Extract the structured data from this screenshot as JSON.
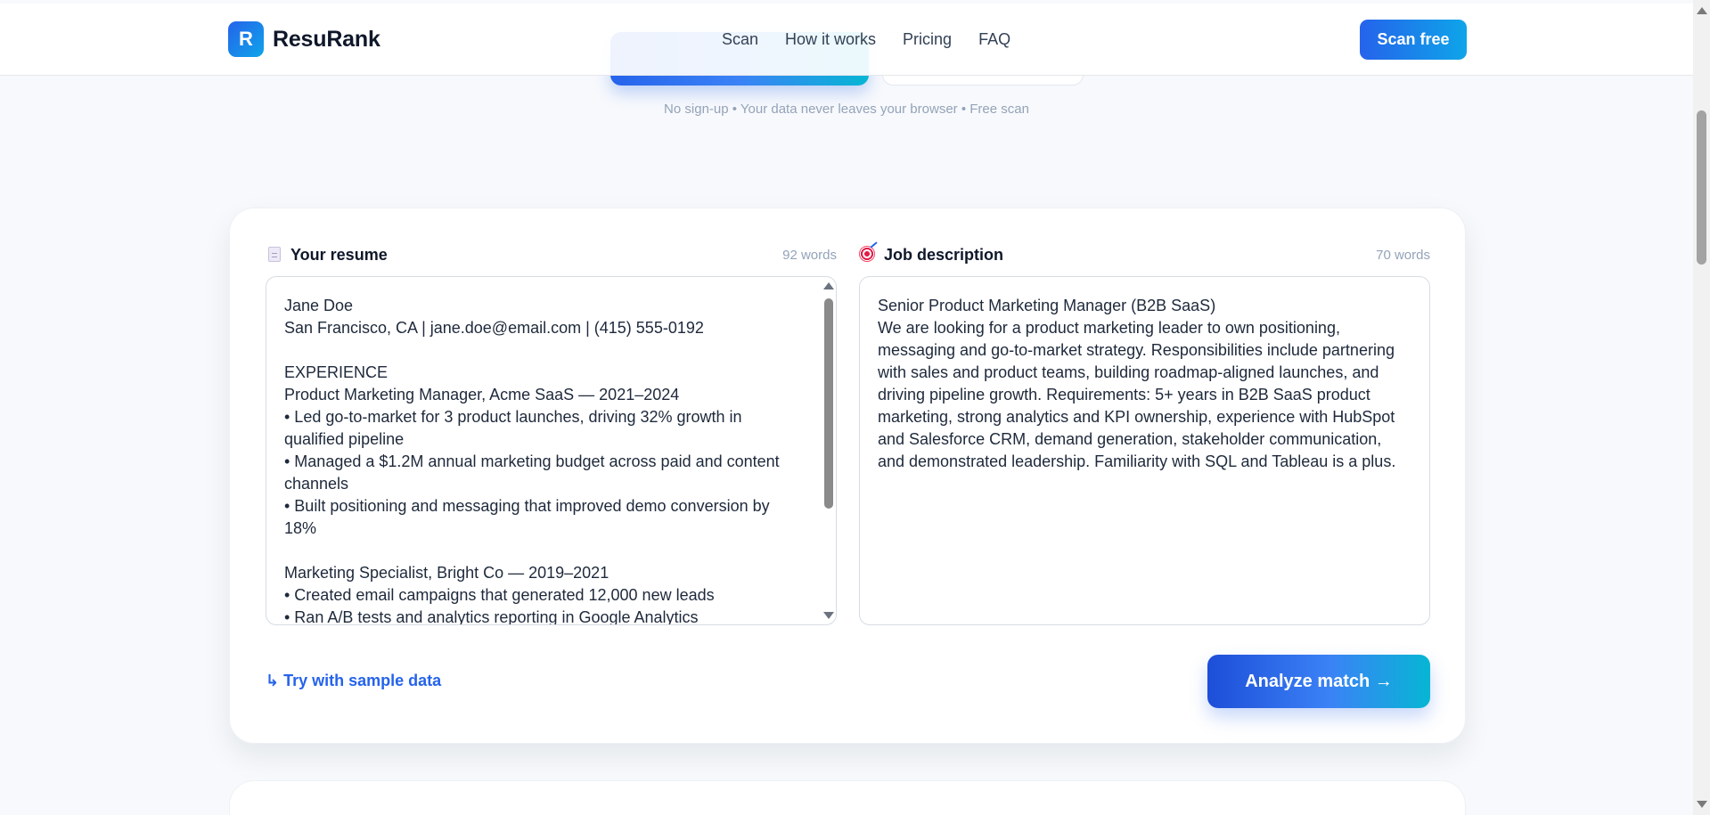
{
  "brand": {
    "logo_letter": "R",
    "name": "ResuRank"
  },
  "nav": {
    "items": [
      {
        "label": "Scan"
      },
      {
        "label": "How it works"
      },
      {
        "label": "Pricing"
      },
      {
        "label": "FAQ"
      }
    ],
    "cta_label": "Scan free"
  },
  "hero": {
    "note": "No sign-up • Your data never leaves your browser • Free scan"
  },
  "resume": {
    "title": "Your resume",
    "icon": "document-icon",
    "word_count": "92 words",
    "text": "Jane Doe\nSan Francisco, CA | jane.doe@email.com | (415) 555-0192\n\nEXPERIENCE\nProduct Marketing Manager, Acme SaaS — 2021–2024\n• Led go-to-market for 3 product launches, driving 32% growth in qualified pipeline\n• Managed a $1.2M annual marketing budget across paid and content channels\n• Built positioning and messaging that improved demo conversion by 18%\n\nMarketing Specialist, Bright Co — 2019–2021\n• Created email campaigns that generated 12,000 new leads\n• Ran A/B tests and analytics reporting in Google Analytics"
  },
  "job": {
    "title": "Job description",
    "icon": "target-icon",
    "word_count": "70 words",
    "text": "Senior Product Marketing Manager (B2B SaaS)\nWe are looking for a product marketing leader to own positioning, messaging and go-to-market strategy. Responsibilities include partnering with sales and product teams, building roadmap-aligned launches, and driving pipeline growth. Requirements: 5+ years in B2B SaaS product marketing, strong analytics and KPI ownership, experience with HubSpot and Salesforce CRM, demand generation, stakeholder communication, and demonstrated leadership. Familiarity with SQL and Tableau is a plus."
  },
  "actions": {
    "sample_label": "↳ Try with sample data",
    "analyze_label": "Analyze match →"
  }
}
